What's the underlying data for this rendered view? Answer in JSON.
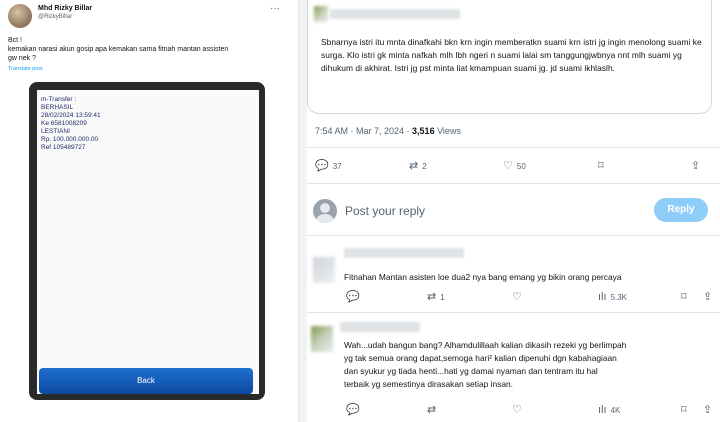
{
  "left_tweet": {
    "name": "Mhd Rizky Billar",
    "handle": "@RizkyBillar",
    "text": "Bct !\nkemakan narasi akun gosip apa kemakan sama fitnah mantan assisten\ngw nek ?",
    "translate": "Translate post",
    "transfer": {
      "text": "m-Transfer :\n   BERHASIL\n   28/02/2024 13:59:41\n   Ke 6581008209\n   LESTIANI\n   Rp. 100.000.000.00\n   Ref 105489727"
    },
    "back_label": "Back"
  },
  "quoted": {
    "text": "Sbnarnya istri itu mnta dinafkahi bkn krn ingin memberatkn suami krn istri jg ingin menolong suami ke surga. Klo istri gk minta nafkah mlh lbh ngeri n suami lalai sm tanggungjwbnya nnt mlh suami yg dihukum di akhirat. Istri jg pst minta liat kmampuan suami jg. jd suami ikhlaslh."
  },
  "meta": {
    "time": "7:54 AM · Mar 7, 2024 · ",
    "views": "3,516",
    "views_label": " Views"
  },
  "actions": {
    "replies": "37",
    "reposts": "2",
    "likes": "50"
  },
  "reply_box": {
    "placeholder": "Post your reply",
    "button": "Reply"
  },
  "comments": [
    {
      "text": "Fitnahan Mantan asisten loe dua2 nya bang emang yg bikin orang percaya",
      "views": "5.3K"
    },
    {
      "text": "Wah...udah bangun bang? Alhamdulillaah kalian dikasih rezeki yg berlimpah\nyg tak semua orang dapat,semoga hari² kalian dipenuhi dgn kabahagiaan\ndan syukur yg tiada henti...hati yg damai nyaman dan tentram itu hal\nterbaik yg semestinya dirasakan setiap insan.",
      "views": "4K"
    }
  ],
  "colors": {
    "accent": "#1d9bf0",
    "reply_button": "#8ecdf8",
    "muted": "#536471"
  }
}
